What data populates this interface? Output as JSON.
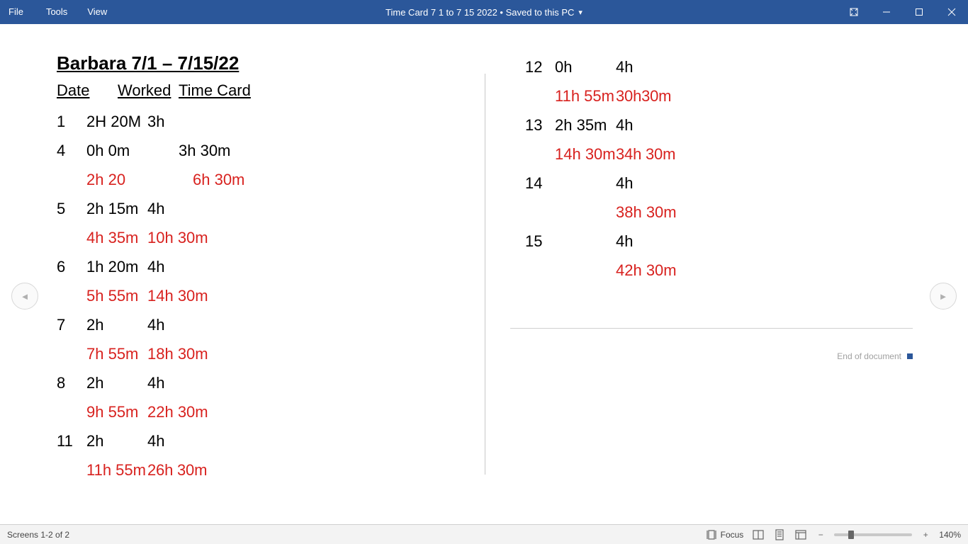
{
  "titlebar": {
    "menus": [
      "File",
      "Tools",
      "View"
    ],
    "title": "Time Card 7 1 to 7 15 2022 • Saved to this PC"
  },
  "document": {
    "heading": "Barbara 7/1 – 7/15/22",
    "columns": {
      "date": "Date",
      "worked": "Worked",
      "timecard": "Time Card"
    },
    "left_rows": [
      {
        "type": "entry",
        "date": "1",
        "worked": "2H 20M",
        "timecard": "3h"
      },
      {
        "type": "entry",
        "date": "4",
        "worked": "0h 0m",
        "timecard": "3h 30m",
        "timecard_offset": true
      },
      {
        "type": "running",
        "worked": "2h 20",
        "timecard": "6h 30m",
        "timecard_offset": true
      },
      {
        "type": "entry",
        "date": "5",
        "worked": "2h 15m",
        "timecard": "4h"
      },
      {
        "type": "running",
        "worked": "4h 35m",
        "timecard": "10h 30m"
      },
      {
        "type": "entry",
        "date": "6",
        "worked": "1h 20m",
        "timecard": "4h"
      },
      {
        "type": "running",
        "worked": "5h 55m",
        "timecard": "14h 30m"
      },
      {
        "type": "entry",
        "date": "7",
        "worked": "2h",
        "timecard": "4h"
      },
      {
        "type": "running",
        "worked": "7h 55m",
        "timecard": "18h 30m"
      },
      {
        "type": "entry",
        "date": "8",
        "worked": "2h",
        "timecard": "4h"
      },
      {
        "type": "running",
        "worked": "9h 55m",
        "timecard": "22h 30m"
      },
      {
        "type": "entry",
        "date": "11",
        "worked": "2h",
        "timecard": "4h"
      },
      {
        "type": "running",
        "worked": "11h 55m",
        "timecard": "26h 30m",
        "tight": true
      }
    ],
    "right_rows": [
      {
        "type": "entry",
        "date": "12",
        "worked": "0h",
        "timecard": "4h"
      },
      {
        "type": "running",
        "worked": "11h 55m",
        "timecard": "30h30m",
        "tight": true
      },
      {
        "type": "entry",
        "date": "13",
        "worked": "2h 35m",
        "timecard": "4h"
      },
      {
        "type": "running",
        "worked": "14h 30m",
        "timecard": "34h 30m",
        "tight": true
      },
      {
        "type": "entry",
        "date": "14",
        "worked": "",
        "timecard": "4h"
      },
      {
        "type": "running",
        "worked": "",
        "timecard": "38h 30m"
      },
      {
        "type": "entry",
        "date": "15",
        "worked": "",
        "timecard": "4h"
      },
      {
        "type": "running",
        "worked": "",
        "timecard": "42h 30m"
      }
    ],
    "end_label": "End of document"
  },
  "statusbar": {
    "screens": "Screens 1-2 of 2",
    "focus": "Focus",
    "zoom": "140%"
  }
}
